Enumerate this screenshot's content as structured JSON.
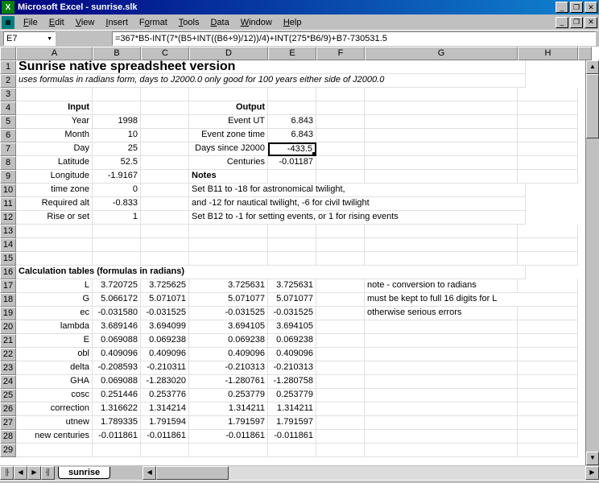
{
  "title": "Microsoft Excel - sunrise.slk",
  "menu": [
    "File",
    "Edit",
    "View",
    "Insert",
    "Format",
    "Tools",
    "Data",
    "Window",
    "Help"
  ],
  "cellref": "E7",
  "formula": "=367*B5-INT(7*(B5+INT((B6+9)/12))/4)+INT(275*B6/9)+B7-730531.5",
  "cols": [
    "A",
    "B",
    "C",
    "D",
    "E",
    "F",
    "G",
    "H"
  ],
  "sheet": "sunrise",
  "r1": {
    "A": "Sunrise native spreadsheet version"
  },
  "r2": {
    "A": "uses formulas in radians form, days to J2000.0 only good for 100 years either side of J2000.0"
  },
  "r4": {
    "A": "Input",
    "D": "Output"
  },
  "r5": {
    "A": "Year",
    "B": "1998",
    "D": "Event UT",
    "E": "6.843"
  },
  "r6": {
    "A": "Month",
    "B": "10",
    "D": "Event zone time",
    "E": "6.843"
  },
  "r7": {
    "A": "Day",
    "B": "25",
    "D": "Days since J2000",
    "E": "-433.5"
  },
  "r8": {
    "A": "Latitude",
    "B": "52.5",
    "D": "Centuries",
    "E": "-0.01187"
  },
  "r9": {
    "A": "Longitude",
    "B": "-1.9167",
    "D": "Notes"
  },
  "r10": {
    "A": "time zone",
    "B": "0",
    "D": "Set B11 to -18 for astronomical twilight,"
  },
  "r11": {
    "A": "Required alt",
    "B": "-0.833",
    "D": "and -12 for nautical twilight, -6 for civil twilight"
  },
  "r12": {
    "A": "Rise or set",
    "B": "1",
    "D": "Set B12 to -1 for setting events, or 1 for rising events"
  },
  "r16": {
    "A": "Calculation tables (formulas in radians)"
  },
  "r17": {
    "A": "L",
    "B": "3.720725",
    "C": "3.725625",
    "D": "3.725631",
    "E": "3.725631",
    "G": "note - conversion to radians"
  },
  "r18": {
    "A": "G",
    "B": "5.066172",
    "C": "5.071071",
    "D": "5.071077",
    "E": "5.071077",
    "G": "must be kept to full 16 digits for L"
  },
  "r19": {
    "A": "ec",
    "B": "-0.031580",
    "C": "-0.031525",
    "D": "-0.031525",
    "E": "-0.031525",
    "G": "otherwise serious errors"
  },
  "r20": {
    "A": "lambda",
    "B": "3.689146",
    "C": "3.694099",
    "D": "3.694105",
    "E": "3.694105"
  },
  "r21": {
    "A": "E",
    "B": "0.069088",
    "C": "0.069238",
    "D": "0.069238",
    "E": "0.069238"
  },
  "r22": {
    "A": "obl",
    "B": "0.409096",
    "C": "0.409096",
    "D": "0.409096",
    "E": "0.409096"
  },
  "r23": {
    "A": "delta",
    "B": "-0.208593",
    "C": "-0.210311",
    "D": "-0.210313",
    "E": "-0.210313"
  },
  "r24": {
    "A": "GHA",
    "B": "0.069088",
    "C": "-1.283020",
    "D": "-1.280761",
    "E": "-1.280758"
  },
  "r25": {
    "A": "cosc",
    "B": "0.251446",
    "C": "0.253776",
    "D": "0.253779",
    "E": "0.253779"
  },
  "r26": {
    "A": "correction",
    "B": "1.316622",
    "C": "1.314214",
    "D": "1.314211",
    "E": "1.314211"
  },
  "r27": {
    "A": "utnew",
    "B": "1.789335",
    "C": "1.791594",
    "D": "1.791597",
    "E": "1.791597"
  },
  "r28": {
    "A": "new centuries",
    "B": "-0.011861",
    "C": "-0.011861",
    "D": "-0.011861",
    "E": "-0.011861"
  }
}
